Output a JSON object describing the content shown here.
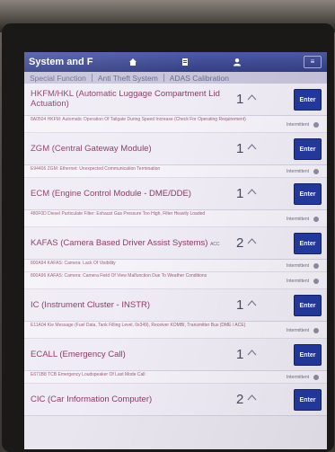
{
  "window": {
    "title": "System and F",
    "menu_label": "≡"
  },
  "toolbar": {
    "home_icon": "home-icon",
    "doc_icon": "document-icon",
    "user_icon": "user-icon"
  },
  "breadcrumbs": [
    "Special Function",
    "Anti Theft System",
    "ADAS Calibration"
  ],
  "modules": [
    {
      "name": "HKFM/HKL (Automatic Luggage Compartment Lid Actuation)",
      "count": "1",
      "enter": "Enter",
      "subs": [
        {
          "text": "8A0504 HKFM: Automatic Operation Of Tailgate During Speed Increase (Check For Operating Requirement)",
          "status": "Intermittent"
        }
      ]
    },
    {
      "name": "ZGM (Central Gateway Module)",
      "count": "1",
      "enter": "Enter",
      "subs": [
        {
          "text": "E94406 ZGM: Ethernet: Unexpected Communication Termination",
          "status": "Intermittent"
        }
      ]
    },
    {
      "name": "ECM (Engine Control Module - DME/DDE)",
      "count": "1",
      "enter": "Enter",
      "subs": [
        {
          "text": "480F0D Diesel Particulate Filter: Exhaust Gas Pressure Too High, Filter Heavily Loaded",
          "status": "Intermittent"
        }
      ]
    },
    {
      "name": "KAFAS (Camera Based Driver Assist Systems)",
      "name_tag": "ACC",
      "count": "2",
      "enter": "Enter",
      "subs": [
        {
          "text": "800A94 KAFAS: Camera: Lack Of Visibility",
          "status": "Intermittent"
        },
        {
          "text": "800A96 KAFAS: Camera: Camera Field Of View Malfunction Due To Weather Conditions",
          "status": "Intermittent"
        }
      ]
    },
    {
      "name": "IC (Instrument Cluster - INSTR)",
      "count": "1",
      "enter": "Enter",
      "subs": [
        {
          "text": "E11A04 Kie Message (Fuel Data, Tank Filling Level, 0x349), Receiver KOMBI, Transmitter Bus (DME / ACE)",
          "status": "Intermittent"
        }
      ]
    },
    {
      "name": "ECALL (Emergency Call)",
      "count": "1",
      "enter": "Enter",
      "subs": [
        {
          "text": "E671B8 TCB Emergency Loudspeaker Of Last Mode Call",
          "status": "Intermittent"
        }
      ]
    },
    {
      "name": "CIC (Car Information Computer)",
      "count": "2",
      "enter": "Enter",
      "subs": []
    }
  ],
  "colors": {
    "accent": "#243a9e",
    "titlebar": "#3b478f",
    "module_text": "#8c3a62"
  }
}
